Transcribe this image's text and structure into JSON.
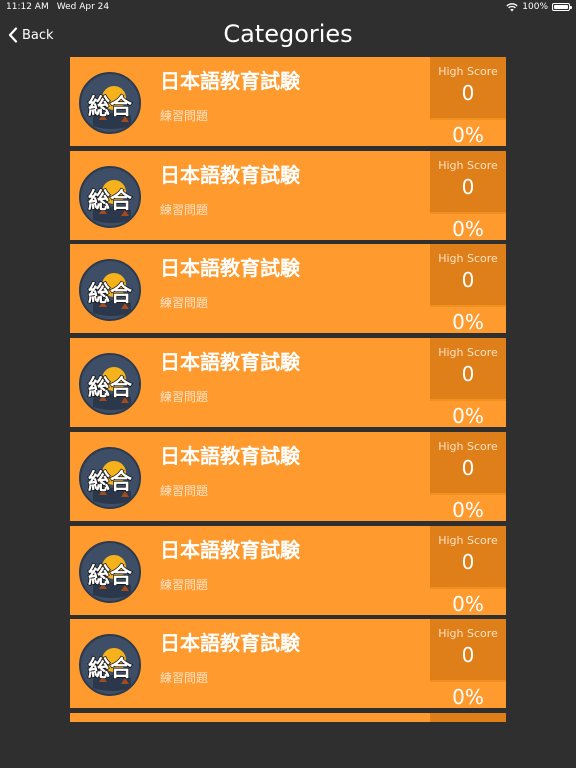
{
  "status": {
    "time": "11:12 AM",
    "date": "Wed Apr 24",
    "battery": "100%",
    "wifi_icon": "wifi-icon",
    "battery_icon": "battery-icon"
  },
  "nav": {
    "back_label": "Back",
    "title": "Categories"
  },
  "colors": {
    "background": "#2f2f2f",
    "row_main": "#fe9a2e",
    "row_side": "#df7f1a"
  },
  "rows": [
    {
      "title": "日本語教育試験",
      "subtitle": "練習問題",
      "badge_text": "総合",
      "high_score_label": "High Score",
      "high_score": "0",
      "percent": "0%"
    },
    {
      "title": "日本語教育試験",
      "subtitle": "練習問題",
      "badge_text": "総合",
      "high_score_label": "High Score",
      "high_score": "0",
      "percent": "0%"
    },
    {
      "title": "日本語教育試験",
      "subtitle": "練習問題",
      "badge_text": "総合",
      "high_score_label": "High Score",
      "high_score": "0",
      "percent": "0%"
    },
    {
      "title": "日本語教育試験",
      "subtitle": "練習問題",
      "badge_text": "総合",
      "high_score_label": "High Score",
      "high_score": "0",
      "percent": "0%"
    },
    {
      "title": "日本語教育試験",
      "subtitle": "練習問題",
      "badge_text": "総合",
      "high_score_label": "High Score",
      "high_score": "0",
      "percent": "0%"
    },
    {
      "title": "日本語教育試験",
      "subtitle": "練習問題",
      "badge_text": "総合",
      "high_score_label": "High Score",
      "high_score": "0",
      "percent": "0%"
    },
    {
      "title": "日本語教育試験",
      "subtitle": "練習問題",
      "badge_text": "総合",
      "high_score_label": "High Score",
      "high_score": "0",
      "percent": "0%"
    }
  ]
}
